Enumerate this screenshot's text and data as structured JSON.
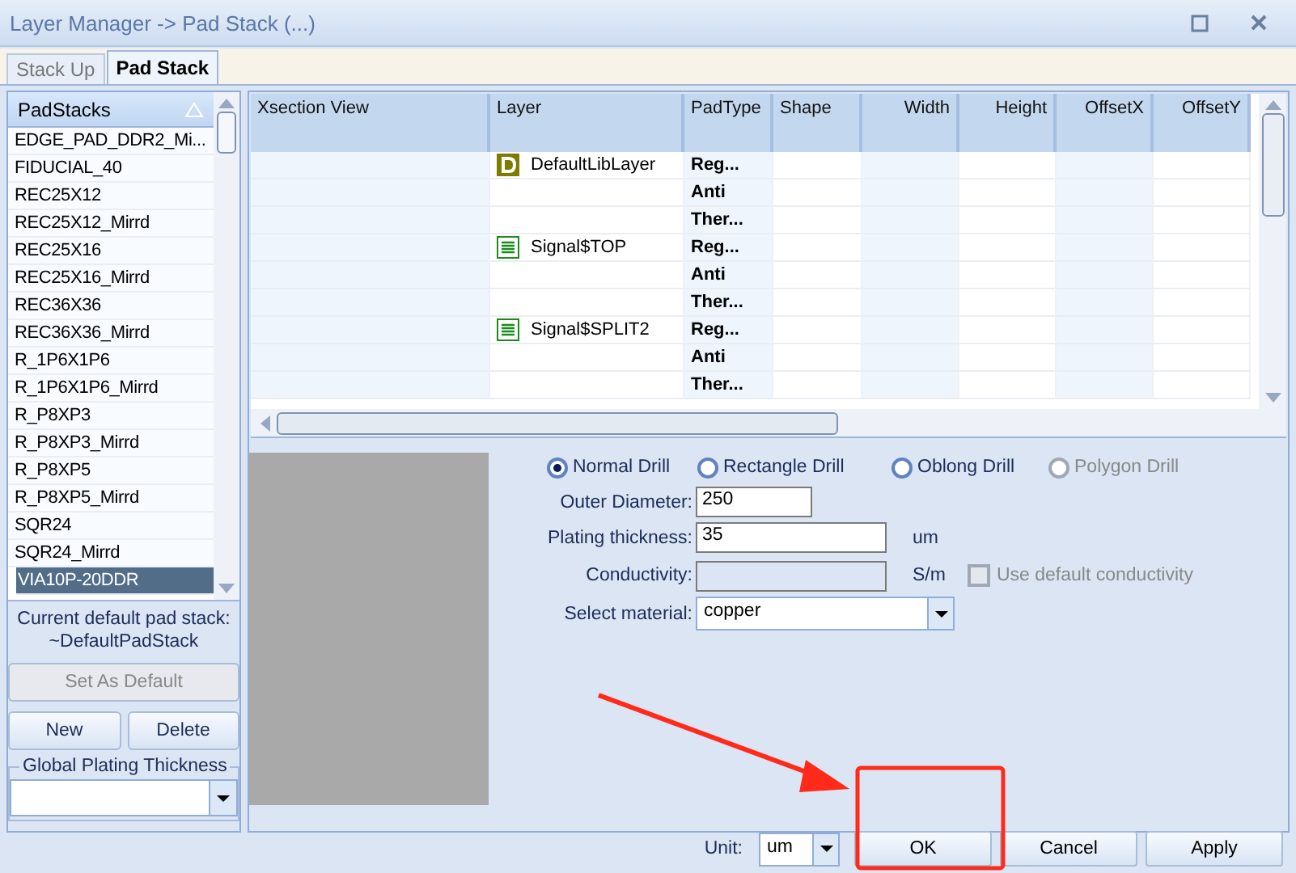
{
  "window": {
    "title": "Layer Manager -> Pad Stack (...)"
  },
  "tabs": [
    {
      "label": "Stack Up",
      "selected": false
    },
    {
      "label": "Pad Stack",
      "selected": true
    }
  ],
  "padstacks": {
    "header": "PadStacks",
    "items": [
      {
        "label": "EDGE_PAD_DDR2_Mi...",
        "selected": false
      },
      {
        "label": "FIDUCIAL_40",
        "selected": false
      },
      {
        "label": "REC25X12",
        "selected": false
      },
      {
        "label": "REC25X12_Mirrd",
        "selected": false
      },
      {
        "label": "REC25X16",
        "selected": false
      },
      {
        "label": "REC25X16_Mirrd",
        "selected": false
      },
      {
        "label": "REC36X36",
        "selected": false
      },
      {
        "label": "REC36X36_Mirrd",
        "selected": false
      },
      {
        "label": "R_1P6X1P6",
        "selected": false
      },
      {
        "label": "R_1P6X1P6_Mirrd",
        "selected": false
      },
      {
        "label": "R_P8XP3",
        "selected": false
      },
      {
        "label": "R_P8XP3_Mirrd",
        "selected": false
      },
      {
        "label": "R_P8XP5",
        "selected": false
      },
      {
        "label": "R_P8XP5_Mirrd",
        "selected": false
      },
      {
        "label": "SQR24",
        "selected": false
      },
      {
        "label": "SQR24_Mirrd",
        "selected": false
      },
      {
        "label": "VIA10P-20DDR",
        "selected": true
      }
    ],
    "current_default_label": "Current default pad stack:",
    "current_default_value": "~DefaultPadStack",
    "buttons": [
      {
        "label": "Set As Default",
        "disabled": true
      },
      {
        "label": "New",
        "disabled": false
      },
      {
        "label": "Delete",
        "disabled": false
      }
    ],
    "global_plating_label": "Global Plating Thickness"
  },
  "grid": {
    "columns": [
      "Xsection View",
      "Layer",
      "PadType",
      "Shape",
      "Width",
      "Height",
      "OffsetX",
      "OffsetY"
    ],
    "rows": [
      {
        "layer": "DefaultLibLayer",
        "kind": "default",
        "pad_types": [
          "Reg...",
          "Anti",
          "Ther..."
        ]
      },
      {
        "layer": "Signal$TOP",
        "kind": "signal",
        "pad_types": [
          "Reg...",
          "Anti",
          "Ther..."
        ]
      },
      {
        "layer": "Signal$SPLIT2",
        "kind": "signal",
        "pad_types": [
          "Reg...",
          "Anti",
          "Ther..."
        ]
      }
    ]
  },
  "drill_types": [
    {
      "label": "Normal Drill",
      "selected": true,
      "disabled": false
    },
    {
      "label": "Rectangle Drill",
      "selected": false,
      "disabled": false
    },
    {
      "label": "Oblong Drill",
      "selected": false,
      "disabled": false
    },
    {
      "label": "Polygon Drill",
      "selected": false,
      "disabled": true
    }
  ],
  "fields": [
    {
      "label": "Outer Diameter:",
      "value": "250",
      "kind": "short"
    },
    {
      "label": "Plating thickness:",
      "value": "35",
      "unit": "um",
      "kind": "long"
    },
    {
      "label": "Conductivity:",
      "unit": "S/m",
      "kind": "disabled",
      "checkbox": {
        "label": "Use default conductivity",
        "checked": false,
        "disabled": true
      }
    },
    {
      "label": "Select material:",
      "value": "copper",
      "kind": "combo"
    }
  ],
  "footer": {
    "unit_label": "Unit:",
    "unit_value": "um",
    "buttons": [
      "OK",
      "Cancel",
      "Apply"
    ]
  },
  "annotations": [
    {
      "kind": "arrow"
    },
    {
      "kind": "highlight_box"
    }
  ]
}
